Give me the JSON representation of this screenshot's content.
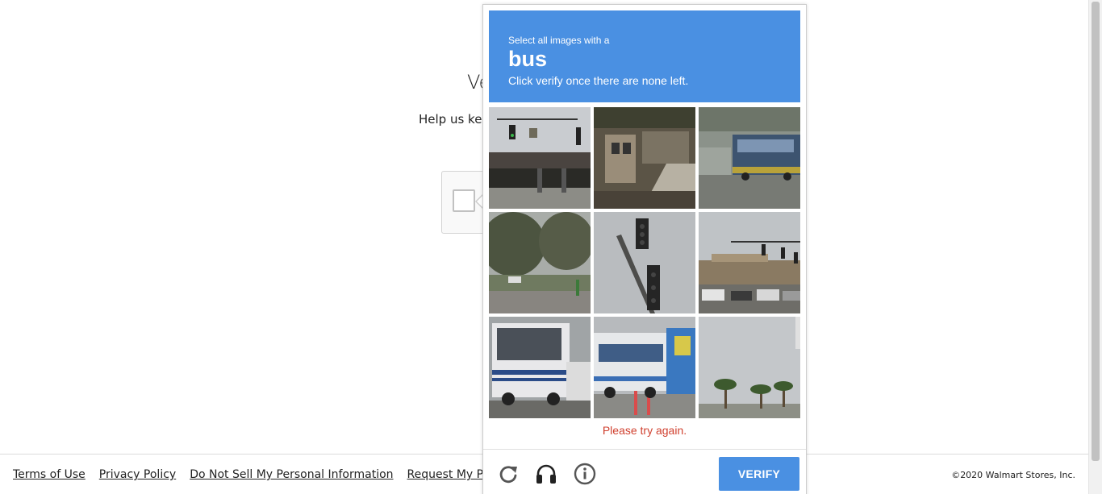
{
  "background_page": {
    "heading_fragment": "Ve",
    "subtext_fragment": "Help us kee"
  },
  "captcha": {
    "instruction_line1": "Select all images with a",
    "keyword": "bus",
    "instruction_line3": "Click verify once there are none left.",
    "tiles": [
      {
        "subject": "traffic light over overpass"
      },
      {
        "subject": "building stairs"
      },
      {
        "subject": "bus on street"
      },
      {
        "subject": "trees and road"
      },
      {
        "subject": "traffic light pole"
      },
      {
        "subject": "traffic light and parking lot"
      },
      {
        "subject": "white rv bus"
      },
      {
        "subject": "city bus"
      },
      {
        "subject": "palm trees"
      }
    ],
    "error_message": "Please try again.",
    "reload_icon": "reload-icon",
    "audio_icon": "headphones-icon",
    "info_icon": "info-icon",
    "verify_label": "VERIFY",
    "accent_color": "#4a90e2",
    "error_color": "#d0402f"
  },
  "footer": {
    "links": [
      "Terms of Use",
      "Privacy Policy",
      "Do Not Sell My Personal Information",
      "Request My Personal In"
    ],
    "copyright": "©2020 Walmart Stores, Inc."
  }
}
